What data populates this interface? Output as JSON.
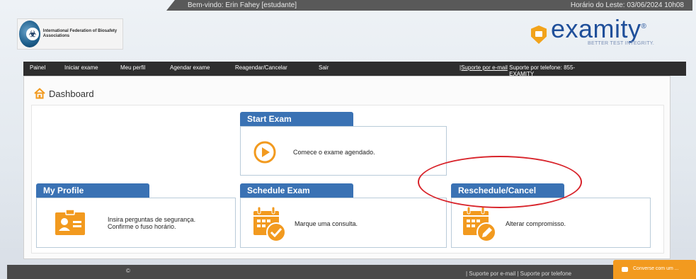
{
  "topbar": {
    "welcome": "Bem-vindo: Erin Fahey [estudante]",
    "time": "Horário do Leste: 03/06/2024 10h08"
  },
  "header": {
    "org_logo_text": "International Federation of Biosafety Associations",
    "brand_name": "examity",
    "brand_tagline": "BETTER TEST INTEGRITY."
  },
  "nav": {
    "items": [
      "Painel",
      "Iniciar exame",
      "Meu perfil",
      "Agendar exame",
      "Reagendar/Cancelar",
      "Sair"
    ],
    "support_email": "|Suporte por e-mail",
    "support_phone": "Suporte por telefone: 855-EXAMITY"
  },
  "dashboard": {
    "title": "Dashboard",
    "cards": {
      "start_exam": {
        "title": "Start Exam",
        "text": "Comece o exame agendado."
      },
      "my_profile": {
        "title": "My Profile",
        "line1": "Insira perguntas de segurança.",
        "line2": "Confirme o fuso horário."
      },
      "schedule_exam": {
        "title": "Schedule Exam",
        "text": "Marque uma consulta."
      },
      "reschedule_cancel": {
        "title": "Reschedule/Cancel",
        "text": "Alterar compromisso."
      }
    }
  },
  "footer": {
    "copyright": "©",
    "links": "|  Suporte por e-mail   |  Suporte por telefone"
  },
  "chat": {
    "label": "Converse com um ..."
  },
  "colors": {
    "accent_blue": "#3a72b4",
    "brand_orange": "#f29a1f",
    "annotation_red": "#d8232a"
  }
}
